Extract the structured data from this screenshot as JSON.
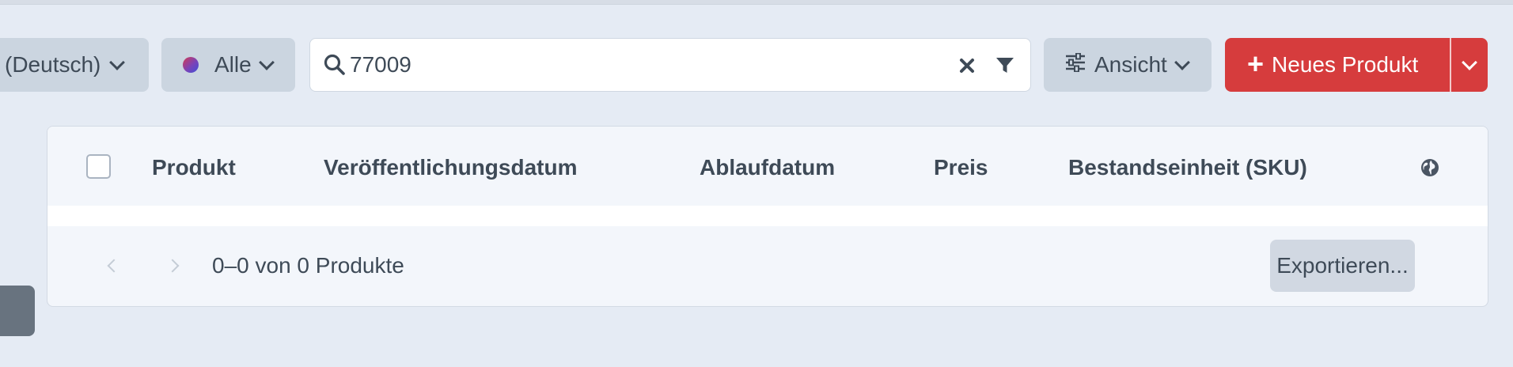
{
  "toolbar": {
    "language_select": {
      "label": "(Deutsch)"
    },
    "status_select": {
      "label": "Alle"
    },
    "search": {
      "value": "77009",
      "placeholder": ""
    },
    "view_button": {
      "label": "Ansicht"
    },
    "new_product": {
      "label": "Neues Produkt"
    }
  },
  "table": {
    "columns": [
      "Produkt",
      "Veröffentlichungsdatum",
      "Ablaufdatum",
      "Preis",
      "Bestandseinheit (SKU)"
    ],
    "rows": [],
    "footer": {
      "page_info": "0–0 von 0 Produkte",
      "export_label": "Exportieren..."
    }
  },
  "icons": {
    "status_dot": "status-gradient-dot-icon",
    "search": "search-icon",
    "clear": "close-icon",
    "filter": "filter-icon",
    "view": "sliders-icon",
    "add": "plus-icon",
    "dropdown": "chevron-down-icon",
    "globe": "globe-icon"
  },
  "colors": {
    "background": "#e5ebf4",
    "primary": "#d63c3d",
    "neutral_button": "#cbd5e0",
    "text": "#3e4a57"
  }
}
